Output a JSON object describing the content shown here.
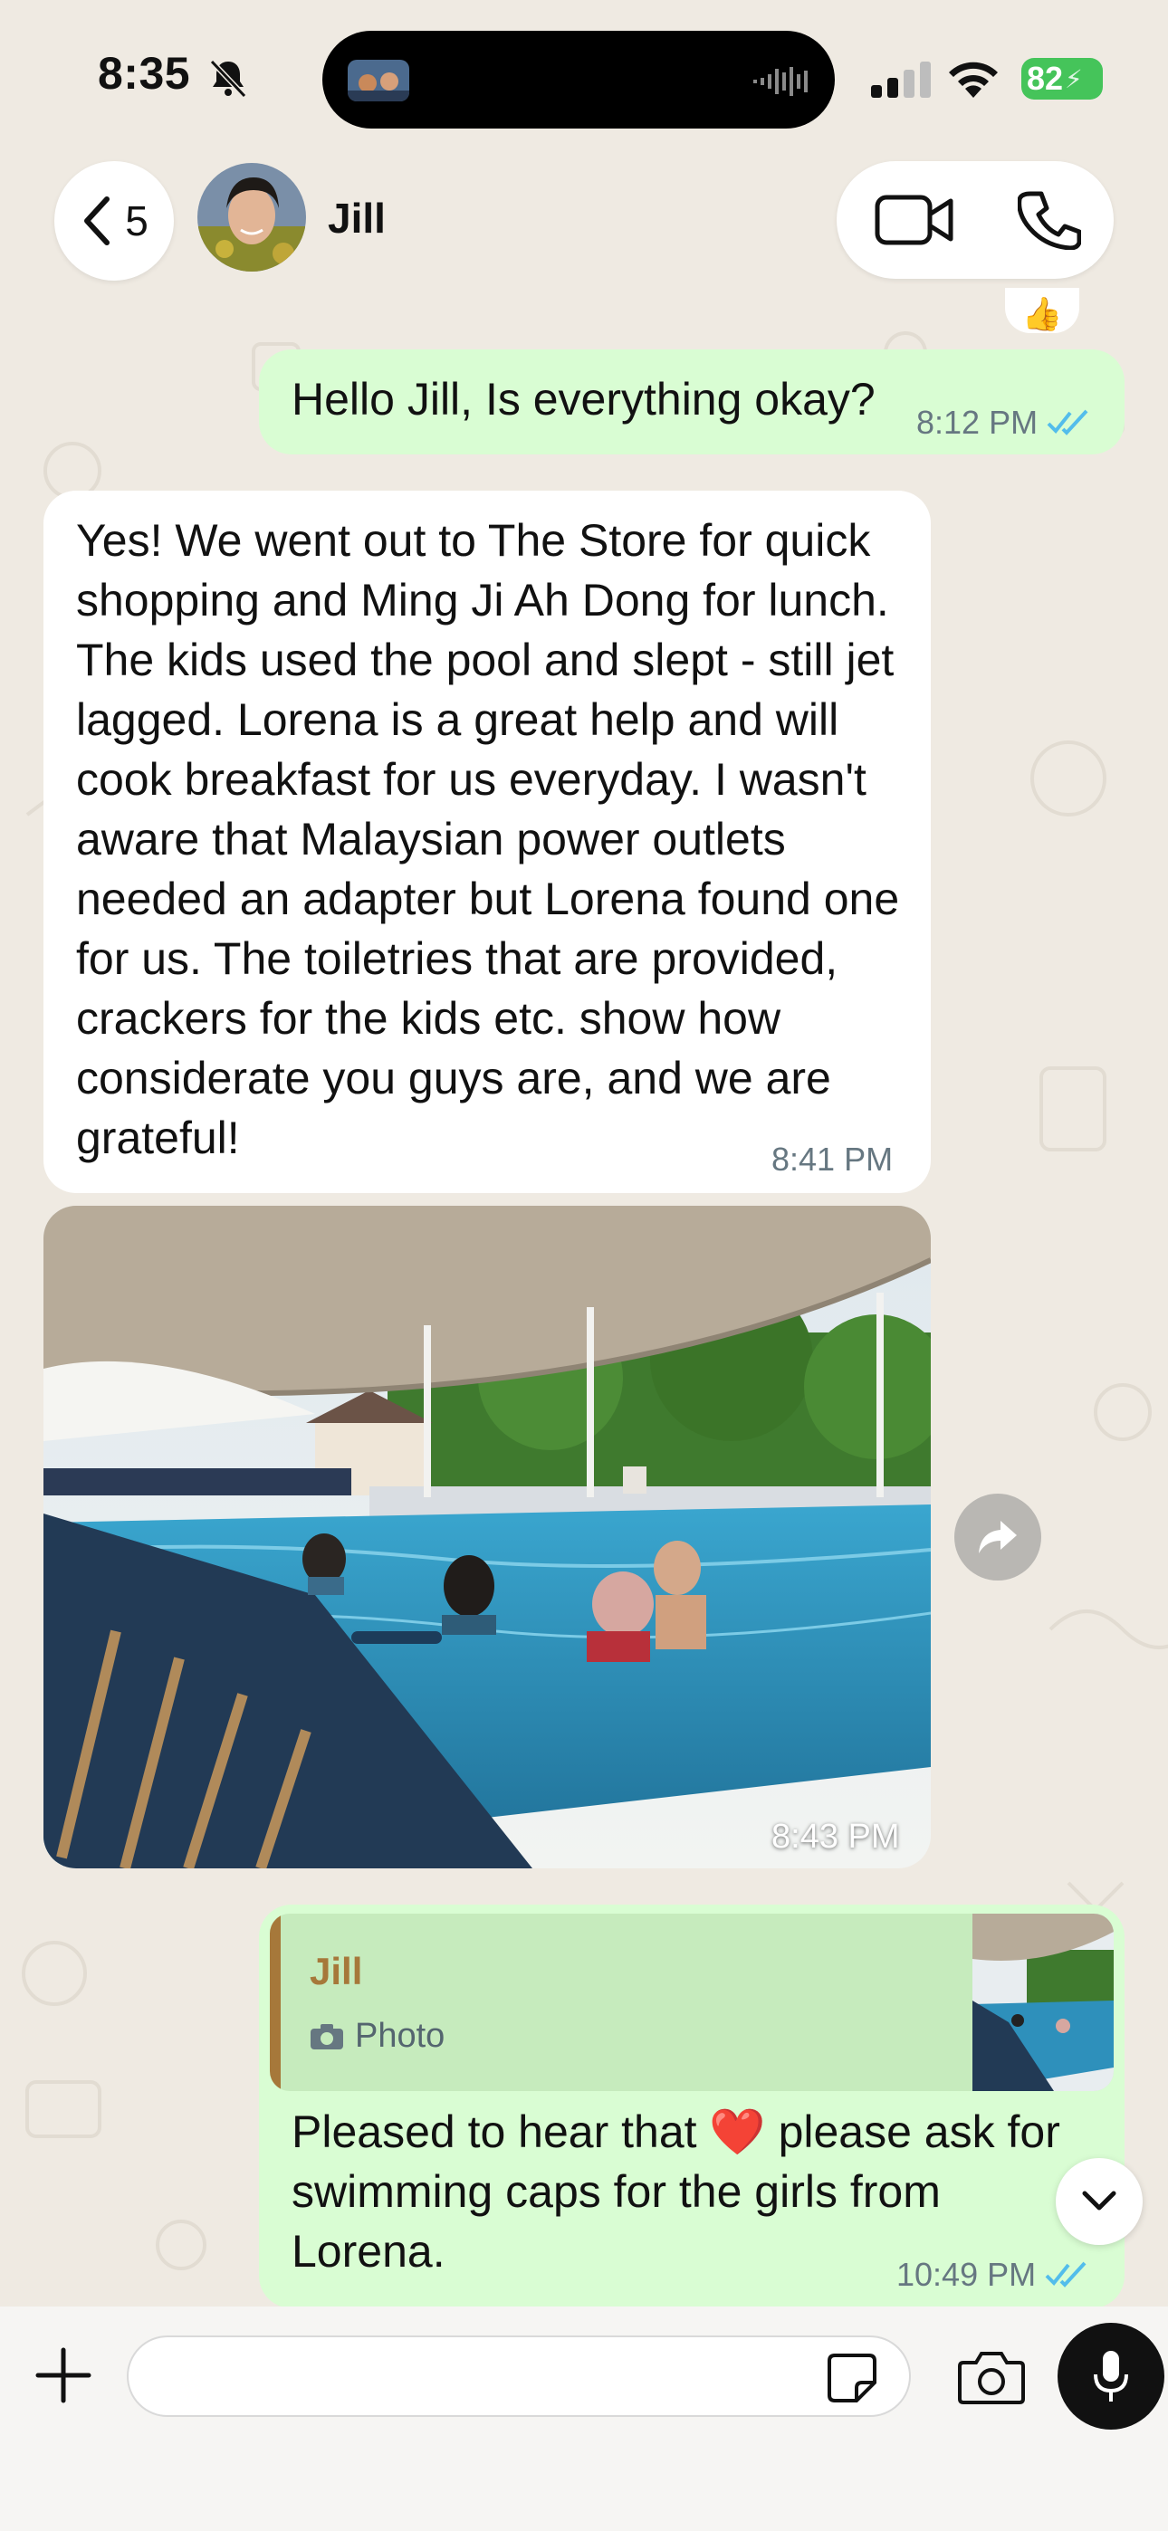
{
  "status_bar": {
    "time": "8:35",
    "battery": "82"
  },
  "header": {
    "back_count": "5",
    "contact_name": "Jill"
  },
  "messages": [
    {
      "text": "Hello Jill, Is everything okay?",
      "time": "8:12 PM",
      "reaction": "👍"
    },
    {
      "text": "Yes! We went out to The Store for quick shopping and Ming Ji Ah Dong for lunch. The kids used the pool and slept - still jet lagged. Lorena is a great help and will cook breakfast for us everyday. I wasn't aware that Malaysian power outlets needed an adapter but Lorena found one for us. The toiletries that are provided, crackers for the kids etc. show how considerate you guys are, and we are grateful!",
      "time": "8:41 PM"
    },
    {
      "time": "8:43 PM"
    },
    {
      "quote_author": "Jill",
      "quote_type": "Photo",
      "text": "Pleased to hear that ❤️ please ask for swimming caps for the girls from Lorena.",
      "time": "10:49 PM"
    }
  ],
  "colors": {
    "outgoing_bubble": "#d9fdd3",
    "incoming_bubble": "#ffffff",
    "read_ticks": "#53bdeb",
    "quote_accent": "#a6783a",
    "chat_background": "#efeae2"
  }
}
